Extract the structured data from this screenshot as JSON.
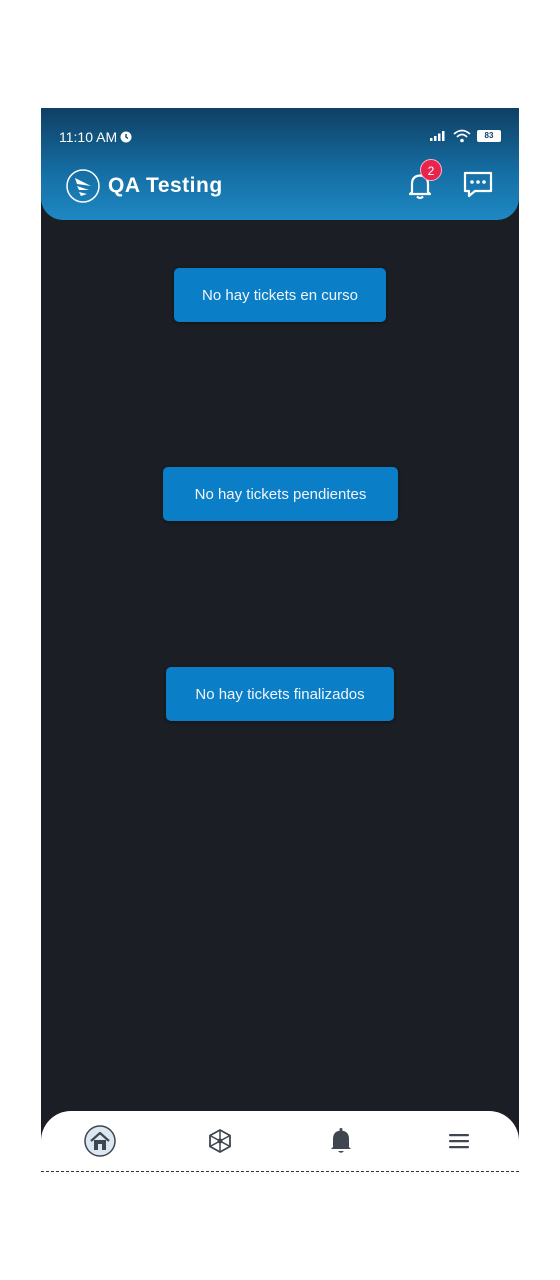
{
  "status_bar": {
    "time": "11:10 AM",
    "battery": "83",
    "icons": [
      "alarm-icon",
      "signal-icon",
      "wifi-icon",
      "battery-icon"
    ]
  },
  "header": {
    "title": "QA Testing",
    "logo": "brand-logo",
    "notification_count": "2",
    "icons": [
      "bell-icon",
      "chat-icon"
    ]
  },
  "main": {
    "messages": [
      "No hay tickets en curso",
      "No hay tickets pendientes",
      "No hay tickets finalizados"
    ]
  },
  "bottom_nav": {
    "items": [
      "home-icon",
      "network-icon",
      "bell-icon",
      "menu-icon"
    ],
    "active": "home-icon"
  },
  "colors": {
    "header_gradient_top": "#0f3f64",
    "header_gradient_bottom": "#1e88c4",
    "background": "#1b1e24",
    "notice": "#0a7ec6",
    "badge": "#e8244d",
    "nav_icon": "#3f4650"
  }
}
